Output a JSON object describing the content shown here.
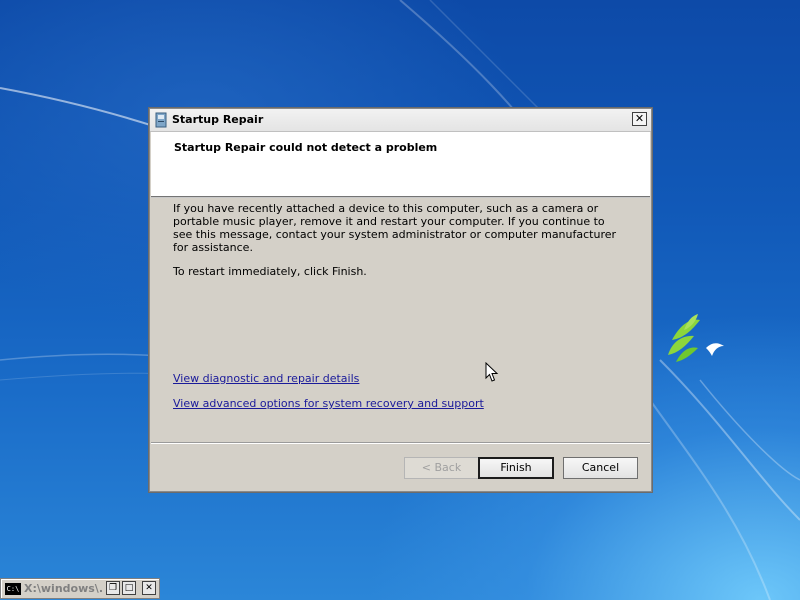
{
  "dialog": {
    "title": "Startup Repair",
    "close_glyph": "✕",
    "header_title": "Startup Repair could not detect a problem",
    "message": "If you have recently attached a device to this computer, such as a camera or portable music player, remove it and restart your computer. If you continue to see this message, contact your system administrator or computer manufacturer for assistance.",
    "restart_instruction": "To restart immediately, click Finish.",
    "links": {
      "diagnostic": "View diagnostic and repair details",
      "advanced": "View advanced options for system recovery and support"
    },
    "buttons": {
      "back": "< Back",
      "finish": "Finish",
      "cancel": "Cancel"
    },
    "back_enabled": false
  },
  "taskbar_window": {
    "title": "X:\\windows\\...",
    "icon_text": "C:\\",
    "restore_glyph": "❐",
    "maximize_glyph": "□",
    "close_glyph": "✕"
  },
  "colors": {
    "desktop_blue": "#1159b8",
    "dialog_face": "#d4d0c8",
    "link_blue": "#1a1a9a"
  }
}
